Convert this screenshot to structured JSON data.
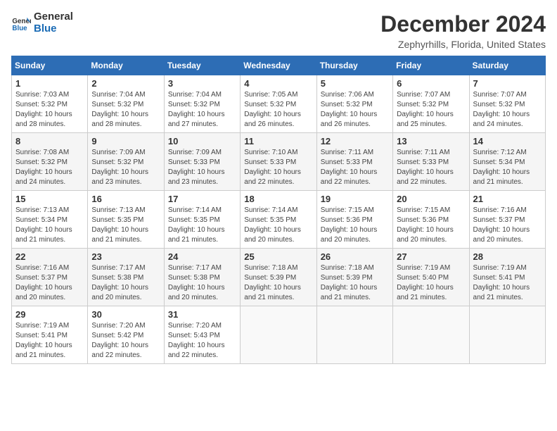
{
  "app": {
    "logo_line1": "General",
    "logo_line2": "Blue"
  },
  "header": {
    "month_year": "December 2024",
    "location": "Zephyrhills, Florida, United States"
  },
  "weekdays": [
    "Sunday",
    "Monday",
    "Tuesday",
    "Wednesday",
    "Thursday",
    "Friday",
    "Saturday"
  ],
  "weeks": [
    [
      {
        "day": "1",
        "info": "Sunrise: 7:03 AM\nSunset: 5:32 PM\nDaylight: 10 hours\nand 28 minutes."
      },
      {
        "day": "2",
        "info": "Sunrise: 7:04 AM\nSunset: 5:32 PM\nDaylight: 10 hours\nand 28 minutes."
      },
      {
        "day": "3",
        "info": "Sunrise: 7:04 AM\nSunset: 5:32 PM\nDaylight: 10 hours\nand 27 minutes."
      },
      {
        "day": "4",
        "info": "Sunrise: 7:05 AM\nSunset: 5:32 PM\nDaylight: 10 hours\nand 26 minutes."
      },
      {
        "day": "5",
        "info": "Sunrise: 7:06 AM\nSunset: 5:32 PM\nDaylight: 10 hours\nand 26 minutes."
      },
      {
        "day": "6",
        "info": "Sunrise: 7:07 AM\nSunset: 5:32 PM\nDaylight: 10 hours\nand 25 minutes."
      },
      {
        "day": "7",
        "info": "Sunrise: 7:07 AM\nSunset: 5:32 PM\nDaylight: 10 hours\nand 24 minutes."
      }
    ],
    [
      {
        "day": "8",
        "info": "Sunrise: 7:08 AM\nSunset: 5:32 PM\nDaylight: 10 hours\nand 24 minutes."
      },
      {
        "day": "9",
        "info": "Sunrise: 7:09 AM\nSunset: 5:32 PM\nDaylight: 10 hours\nand 23 minutes."
      },
      {
        "day": "10",
        "info": "Sunrise: 7:09 AM\nSunset: 5:33 PM\nDaylight: 10 hours\nand 23 minutes."
      },
      {
        "day": "11",
        "info": "Sunrise: 7:10 AM\nSunset: 5:33 PM\nDaylight: 10 hours\nand 22 minutes."
      },
      {
        "day": "12",
        "info": "Sunrise: 7:11 AM\nSunset: 5:33 PM\nDaylight: 10 hours\nand 22 minutes."
      },
      {
        "day": "13",
        "info": "Sunrise: 7:11 AM\nSunset: 5:33 PM\nDaylight: 10 hours\nand 22 minutes."
      },
      {
        "day": "14",
        "info": "Sunrise: 7:12 AM\nSunset: 5:34 PM\nDaylight: 10 hours\nand 21 minutes."
      }
    ],
    [
      {
        "day": "15",
        "info": "Sunrise: 7:13 AM\nSunset: 5:34 PM\nDaylight: 10 hours\nand 21 minutes."
      },
      {
        "day": "16",
        "info": "Sunrise: 7:13 AM\nSunset: 5:35 PM\nDaylight: 10 hours\nand 21 minutes."
      },
      {
        "day": "17",
        "info": "Sunrise: 7:14 AM\nSunset: 5:35 PM\nDaylight: 10 hours\nand 21 minutes."
      },
      {
        "day": "18",
        "info": "Sunrise: 7:14 AM\nSunset: 5:35 PM\nDaylight: 10 hours\nand 20 minutes."
      },
      {
        "day": "19",
        "info": "Sunrise: 7:15 AM\nSunset: 5:36 PM\nDaylight: 10 hours\nand 20 minutes."
      },
      {
        "day": "20",
        "info": "Sunrise: 7:15 AM\nSunset: 5:36 PM\nDaylight: 10 hours\nand 20 minutes."
      },
      {
        "day": "21",
        "info": "Sunrise: 7:16 AM\nSunset: 5:37 PM\nDaylight: 10 hours\nand 20 minutes."
      }
    ],
    [
      {
        "day": "22",
        "info": "Sunrise: 7:16 AM\nSunset: 5:37 PM\nDaylight: 10 hours\nand 20 minutes."
      },
      {
        "day": "23",
        "info": "Sunrise: 7:17 AM\nSunset: 5:38 PM\nDaylight: 10 hours\nand 20 minutes."
      },
      {
        "day": "24",
        "info": "Sunrise: 7:17 AM\nSunset: 5:38 PM\nDaylight: 10 hours\nand 20 minutes."
      },
      {
        "day": "25",
        "info": "Sunrise: 7:18 AM\nSunset: 5:39 PM\nDaylight: 10 hours\nand 21 minutes."
      },
      {
        "day": "26",
        "info": "Sunrise: 7:18 AM\nSunset: 5:39 PM\nDaylight: 10 hours\nand 21 minutes."
      },
      {
        "day": "27",
        "info": "Sunrise: 7:19 AM\nSunset: 5:40 PM\nDaylight: 10 hours\nand 21 minutes."
      },
      {
        "day": "28",
        "info": "Sunrise: 7:19 AM\nSunset: 5:41 PM\nDaylight: 10 hours\nand 21 minutes."
      }
    ],
    [
      {
        "day": "29",
        "info": "Sunrise: 7:19 AM\nSunset: 5:41 PM\nDaylight: 10 hours\nand 21 minutes."
      },
      {
        "day": "30",
        "info": "Sunrise: 7:20 AM\nSunset: 5:42 PM\nDaylight: 10 hours\nand 22 minutes."
      },
      {
        "day": "31",
        "info": "Sunrise: 7:20 AM\nSunset: 5:43 PM\nDaylight: 10 hours\nand 22 minutes."
      },
      {
        "day": "",
        "info": ""
      },
      {
        "day": "",
        "info": ""
      },
      {
        "day": "",
        "info": ""
      },
      {
        "day": "",
        "info": ""
      }
    ]
  ]
}
